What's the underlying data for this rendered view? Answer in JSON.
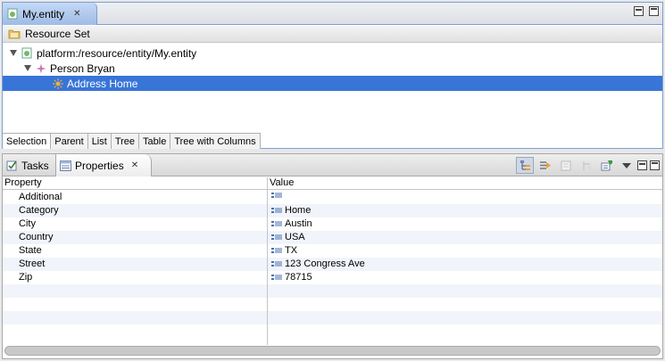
{
  "editor": {
    "tab_label": "My.entity",
    "resource_set_label": "Resource Set",
    "tree": [
      {
        "label": "platform:/resource/entity/My.entity",
        "icon": "entity-file-icon",
        "selected": false
      },
      {
        "label": "Person Bryan",
        "icon": "person-icon",
        "selected": false
      },
      {
        "label": "Address Home",
        "icon": "address-icon",
        "selected": true
      }
    ],
    "bottom_tabs": [
      "Selection",
      "Parent",
      "List",
      "Tree",
      "Table",
      "Tree with Columns"
    ]
  },
  "properties_view": {
    "tabs": [
      "Tasks",
      "Properties"
    ],
    "columns": [
      "Property",
      "Value"
    ],
    "rows": [
      {
        "property": "Additional",
        "value": ""
      },
      {
        "property": "Category",
        "value": "Home"
      },
      {
        "property": "City",
        "value": "Austin"
      },
      {
        "property": "Country",
        "value": "USA"
      },
      {
        "property": "State",
        "value": "TX"
      },
      {
        "property": "Street",
        "value": "123 Congress Ave"
      },
      {
        "property": "Zip",
        "value": "78715"
      }
    ]
  },
  "colors": {
    "selection": "#3875d7",
    "editor_border": "#7c9fd3",
    "row_alternate": "#f1f4fa"
  }
}
